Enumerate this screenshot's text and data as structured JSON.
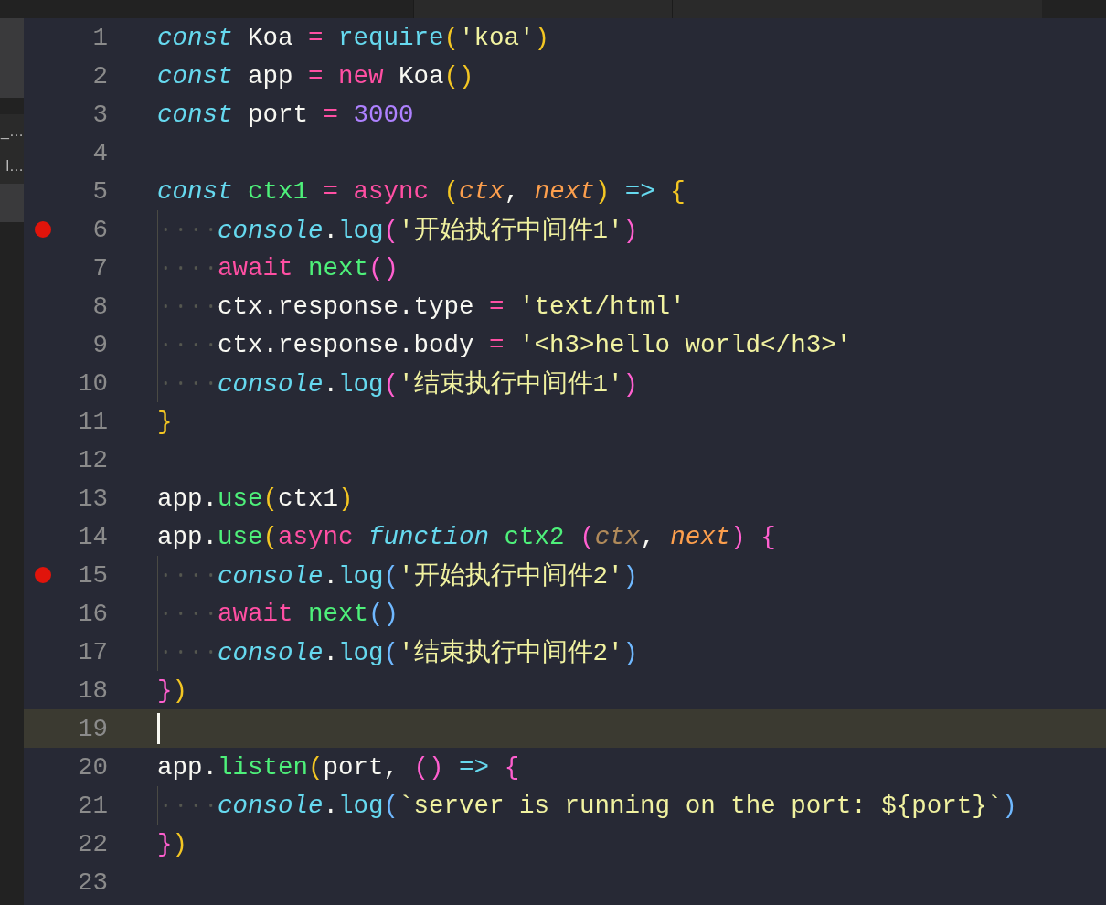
{
  "sidebar": {
    "items": [
      {
        "label": "_…",
        "selected": false
      },
      {
        "label": "l…",
        "selected": false
      }
    ]
  },
  "editor": {
    "lines": [
      {
        "number": "1",
        "breakpoint": false,
        "current": false,
        "indented": false,
        "tokens": [
          {
            "kind": "storage",
            "text": "const"
          },
          {
            "kind": "plain",
            "text": " Koa "
          },
          {
            "kind": "operator",
            "text": "= "
          },
          {
            "kind": "function",
            "text": "require"
          },
          {
            "kind": "bracket1",
            "text": "("
          },
          {
            "kind": "string",
            "text": "'koa'"
          },
          {
            "kind": "bracket1",
            "text": ")"
          }
        ]
      },
      {
        "number": "2",
        "breakpoint": false,
        "current": false,
        "indented": false,
        "tokens": [
          {
            "kind": "storage",
            "text": "const"
          },
          {
            "kind": "plain",
            "text": " app "
          },
          {
            "kind": "operator",
            "text": "= "
          },
          {
            "kind": "keyword",
            "text": "new"
          },
          {
            "kind": "plain",
            "text": " Koa"
          },
          {
            "kind": "bracket1",
            "text": "()"
          }
        ]
      },
      {
        "number": "3",
        "breakpoint": false,
        "current": false,
        "indented": false,
        "tokens": [
          {
            "kind": "storage",
            "text": "const"
          },
          {
            "kind": "plain",
            "text": " port "
          },
          {
            "kind": "operator",
            "text": "= "
          },
          {
            "kind": "number",
            "text": "3000"
          }
        ]
      },
      {
        "number": "4",
        "breakpoint": false,
        "current": false,
        "indented": false
      },
      {
        "number": "5",
        "breakpoint": false,
        "current": false,
        "indented": false,
        "tokens": [
          {
            "kind": "storage",
            "text": "const "
          },
          {
            "kind": "name",
            "text": "ctx1 "
          },
          {
            "kind": "operator",
            "text": "= "
          },
          {
            "kind": "keyword",
            "text": "async "
          },
          {
            "kind": "bracket1",
            "text": "("
          },
          {
            "kind": "param",
            "text": "ctx"
          },
          {
            "kind": "plain",
            "text": ", "
          },
          {
            "kind": "param",
            "text": "next"
          },
          {
            "kind": "bracket1",
            "text": ") "
          },
          {
            "kind": "arrow",
            "text": "=> "
          },
          {
            "kind": "bracket1",
            "text": "{"
          }
        ]
      },
      {
        "number": "6",
        "breakpoint": true,
        "current": false,
        "indented": true,
        "tokens": [
          {
            "kind": "storage",
            "text": "console"
          },
          {
            "kind": "plain",
            "text": "."
          },
          {
            "kind": "function",
            "text": "log"
          },
          {
            "kind": "bracket2",
            "text": "("
          },
          {
            "kind": "string",
            "text": "'开始执行中间件1'"
          },
          {
            "kind": "bracket2",
            "text": ")"
          }
        ]
      },
      {
        "number": "7",
        "breakpoint": false,
        "current": false,
        "indented": true,
        "tokens": [
          {
            "kind": "keyword",
            "text": "await "
          },
          {
            "kind": "name",
            "text": "next"
          },
          {
            "kind": "bracket2",
            "text": "()"
          }
        ]
      },
      {
        "number": "8",
        "breakpoint": false,
        "current": false,
        "indented": true,
        "tokens": [
          {
            "kind": "plain",
            "text": "ctx.response.type "
          },
          {
            "kind": "operator",
            "text": "= "
          },
          {
            "kind": "string",
            "text": "'text/html'"
          }
        ]
      },
      {
        "number": "9",
        "breakpoint": false,
        "current": false,
        "indented": true,
        "tokens": [
          {
            "kind": "plain",
            "text": "ctx.response.body "
          },
          {
            "kind": "operator",
            "text": "= "
          },
          {
            "kind": "string",
            "text": "'<h3>hello world</h3>'"
          }
        ]
      },
      {
        "number": "10",
        "breakpoint": false,
        "current": false,
        "indented": true,
        "tokens": [
          {
            "kind": "storage",
            "text": "console"
          },
          {
            "kind": "plain",
            "text": "."
          },
          {
            "kind": "function",
            "text": "log"
          },
          {
            "kind": "bracket2",
            "text": "("
          },
          {
            "kind": "string",
            "text": "'结束执行中间件1'"
          },
          {
            "kind": "bracket2",
            "text": ")"
          }
        ]
      },
      {
        "number": "11",
        "breakpoint": false,
        "current": false,
        "indented": false,
        "tokens": [
          {
            "kind": "bracket1",
            "text": "}"
          }
        ]
      },
      {
        "number": "12",
        "breakpoint": false,
        "current": false,
        "indented": false
      },
      {
        "number": "13",
        "breakpoint": false,
        "current": false,
        "indented": false,
        "tokens": [
          {
            "kind": "plain",
            "text": "app."
          },
          {
            "kind": "name",
            "text": "use"
          },
          {
            "kind": "bracket1",
            "text": "("
          },
          {
            "kind": "plain",
            "text": "ctx1"
          },
          {
            "kind": "bracket1",
            "text": ")"
          }
        ]
      },
      {
        "number": "14",
        "breakpoint": false,
        "current": false,
        "indented": false,
        "tokens": [
          {
            "kind": "plain",
            "text": "app."
          },
          {
            "kind": "name",
            "text": "use"
          },
          {
            "kind": "bracket1",
            "text": "("
          },
          {
            "kind": "keyword",
            "text": "async "
          },
          {
            "kind": "storage",
            "text": "function "
          },
          {
            "kind": "name",
            "text": "ctx2 "
          },
          {
            "kind": "bracket2",
            "text": "("
          },
          {
            "kind": "param_dim",
            "text": "ctx"
          },
          {
            "kind": "plain",
            "text": ", "
          },
          {
            "kind": "param",
            "text": "next"
          },
          {
            "kind": "bracket2",
            "text": ") {"
          }
        ]
      },
      {
        "number": "15",
        "breakpoint": true,
        "current": false,
        "indented": true,
        "tokens": [
          {
            "kind": "storage",
            "text": "console"
          },
          {
            "kind": "plain",
            "text": "."
          },
          {
            "kind": "function",
            "text": "log"
          },
          {
            "kind": "bracket3",
            "text": "("
          },
          {
            "kind": "string",
            "text": "'开始执行中间件2'"
          },
          {
            "kind": "bracket3",
            "text": ")"
          }
        ]
      },
      {
        "number": "16",
        "breakpoint": false,
        "current": false,
        "indented": true,
        "tokens": [
          {
            "kind": "keyword",
            "text": "await "
          },
          {
            "kind": "name",
            "text": "next"
          },
          {
            "kind": "bracket3",
            "text": "()"
          }
        ]
      },
      {
        "number": "17",
        "breakpoint": false,
        "current": false,
        "indented": true,
        "tokens": [
          {
            "kind": "storage",
            "text": "console"
          },
          {
            "kind": "plain",
            "text": "."
          },
          {
            "kind": "function",
            "text": "log"
          },
          {
            "kind": "bracket3",
            "text": "("
          },
          {
            "kind": "string",
            "text": "'结束执行中间件2'"
          },
          {
            "kind": "bracket3",
            "text": ")"
          }
        ]
      },
      {
        "number": "18",
        "breakpoint": false,
        "current": false,
        "indented": false,
        "tokens": [
          {
            "kind": "bracket2",
            "text": "}"
          },
          {
            "kind": "bracket1",
            "text": ")"
          }
        ]
      },
      {
        "number": "19",
        "breakpoint": false,
        "current": true,
        "indented": false
      },
      {
        "number": "20",
        "breakpoint": false,
        "current": false,
        "indented": false,
        "tokens": [
          {
            "kind": "plain",
            "text": "app."
          },
          {
            "kind": "name",
            "text": "listen"
          },
          {
            "kind": "bracket1",
            "text": "("
          },
          {
            "kind": "plain",
            "text": "port, "
          },
          {
            "kind": "bracket2",
            "text": "() "
          },
          {
            "kind": "arrow",
            "text": "=> "
          },
          {
            "kind": "bracket2",
            "text": "{"
          }
        ]
      },
      {
        "number": "21",
        "breakpoint": false,
        "current": false,
        "indented": true,
        "tokens": [
          {
            "kind": "storage",
            "text": "console"
          },
          {
            "kind": "plain",
            "text": "."
          },
          {
            "kind": "function",
            "text": "log"
          },
          {
            "kind": "bracket3",
            "text": "("
          },
          {
            "kind": "string",
            "text": "`server is running on the port: ${port}`"
          },
          {
            "kind": "bracket3",
            "text": ")"
          }
        ]
      },
      {
        "number": "22",
        "breakpoint": false,
        "current": false,
        "indented": false,
        "tokens": [
          {
            "kind": "bracket2",
            "text": "}"
          },
          {
            "kind": "bracket1",
            "text": ")"
          }
        ]
      },
      {
        "number": "23",
        "breakpoint": false,
        "current": false,
        "indented": false
      }
    ]
  }
}
